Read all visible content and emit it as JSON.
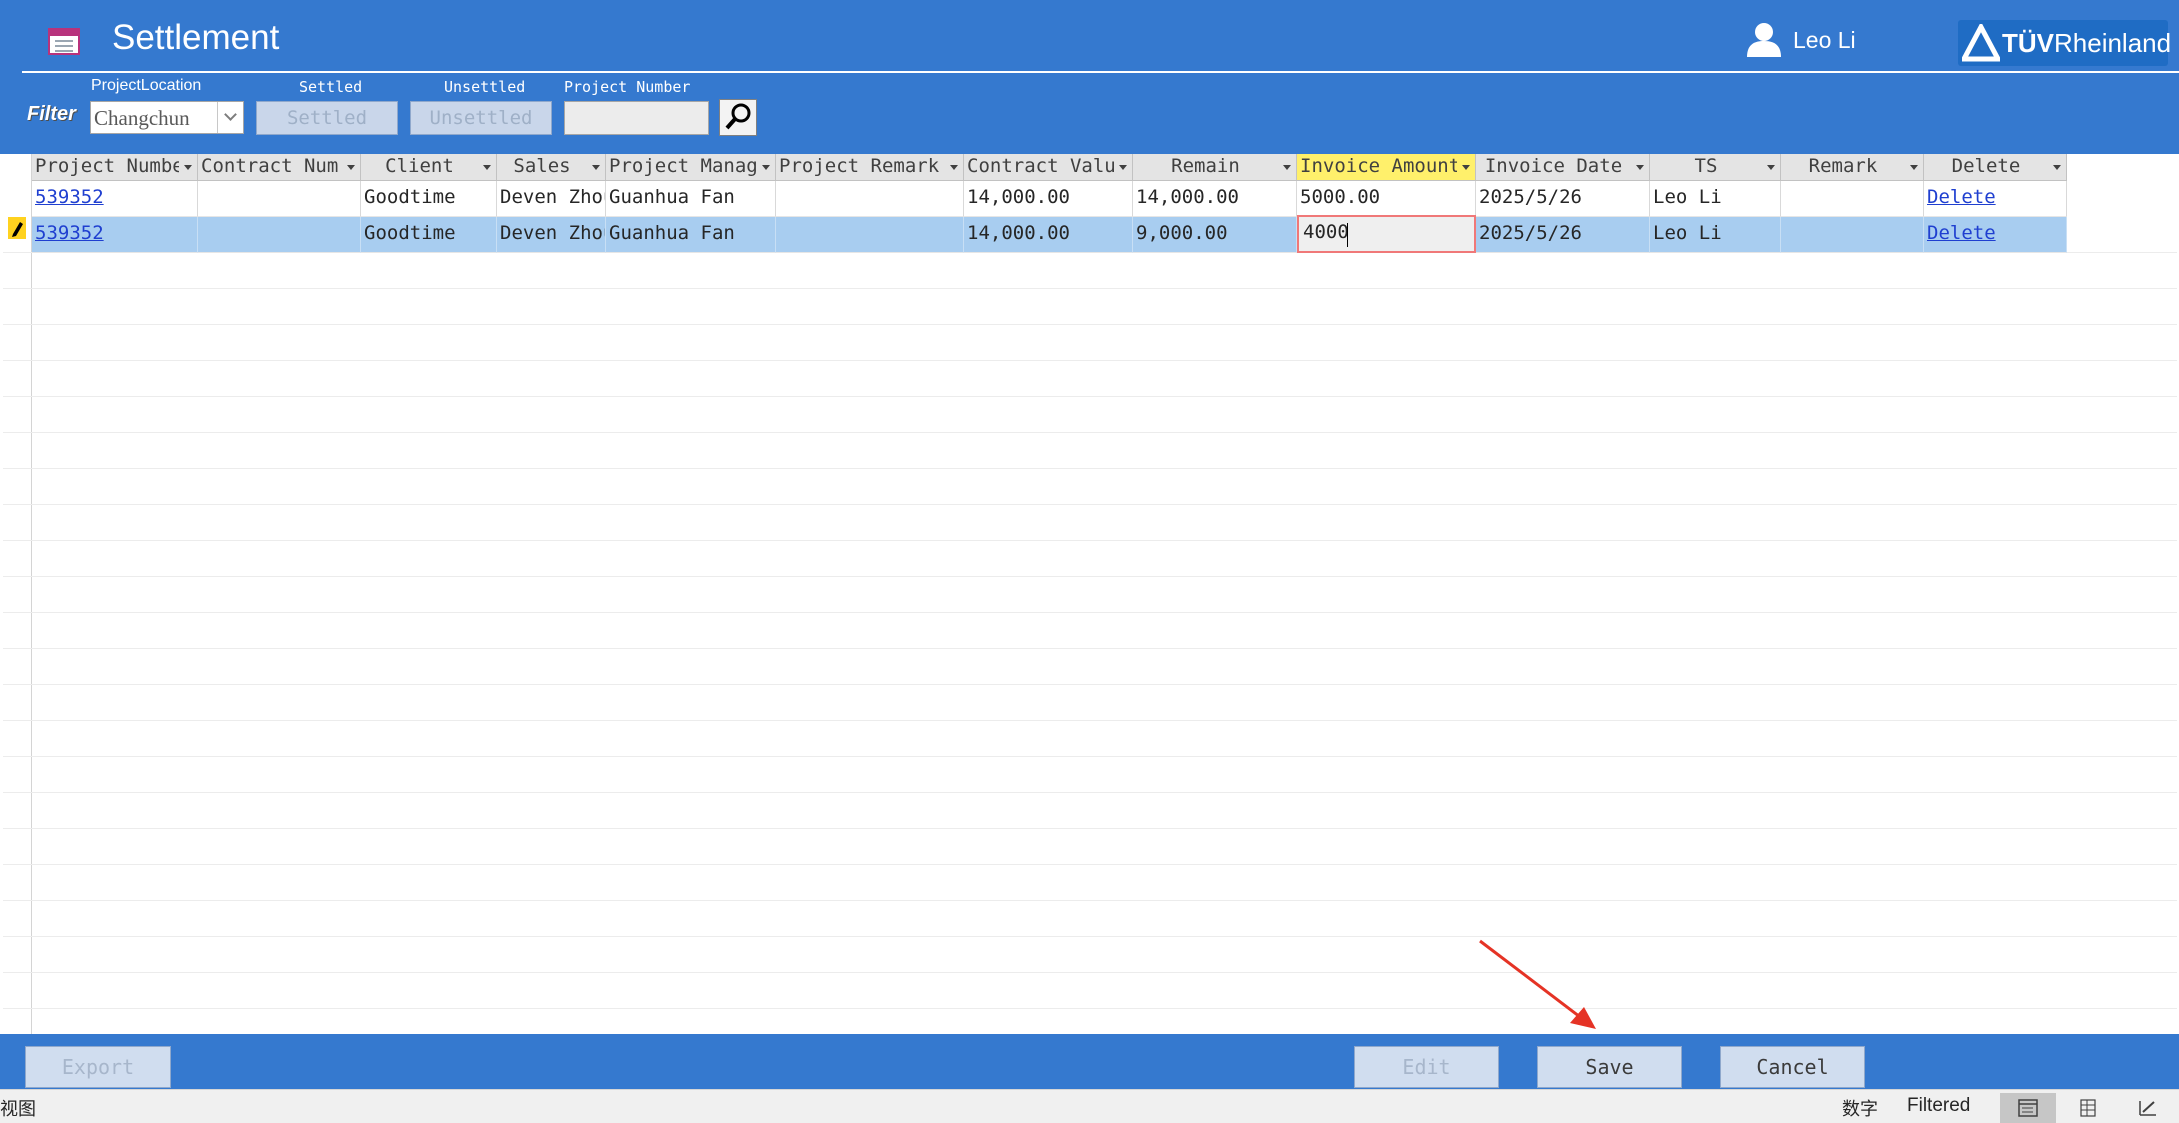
{
  "header": {
    "title": "Settlement",
    "user": "Leo Li",
    "logo_brand": "TÜV",
    "logo_suffix": "Rheinland"
  },
  "filter": {
    "label": "Filter",
    "location_caption": "ProjectLocation",
    "location_value": "Changchun",
    "settled_caption": "Settled",
    "settled_button": "Settled",
    "unsettled_caption": "Unsettled",
    "unsettled_button": "Unsettled",
    "project_number_caption": "Project Number",
    "project_number_value": ""
  },
  "table": {
    "columns": [
      "Project Numbe",
      "Contract Num",
      "Client",
      "Sales",
      "Project Manag",
      "Project Remark",
      "Contract Valu",
      "Remain",
      "Invoice Amount",
      "Invoice Date",
      "TS",
      "Remark",
      "Delete"
    ],
    "active_column": "Invoice Amount",
    "rows": [
      {
        "project_number": "539352",
        "contract_num": "",
        "client": "Goodtime",
        "sales": "Deven Zhou",
        "project_manager": "Guanhua Fan",
        "project_remark": "",
        "contract_value": "14,000.00",
        "remain": "14,000.00",
        "invoice_amount": "5000.00",
        "invoice_date": "2025/5/26",
        "ts": "Leo Li",
        "remark": "",
        "delete": "Delete"
      },
      {
        "project_number": "539352",
        "contract_num": "",
        "client": "Goodtime",
        "sales": "Deven Zhou",
        "project_manager": "Guanhua Fan",
        "project_remark": "",
        "contract_value": "14,000.00",
        "remain": "9,000.00",
        "invoice_amount": "4000",
        "invoice_date": "2025/5/26",
        "ts": "Leo Li",
        "remark": "",
        "delete": "Delete"
      }
    ]
  },
  "footer": {
    "export_label": "Export Excel",
    "edit_label": "Edit",
    "save_label": "Save",
    "cancel_label": "Cancel"
  },
  "statusbar": {
    "left_text": "视图",
    "num_text": "数字",
    "filter_state": "Filtered"
  },
  "colors": {
    "header_bg": "#3579cf",
    "active_column_bg": "#fff06b",
    "selected_row_bg": "#a8cdf0",
    "link": "#1f3fd0",
    "annotation_arrow": "#e53325"
  }
}
